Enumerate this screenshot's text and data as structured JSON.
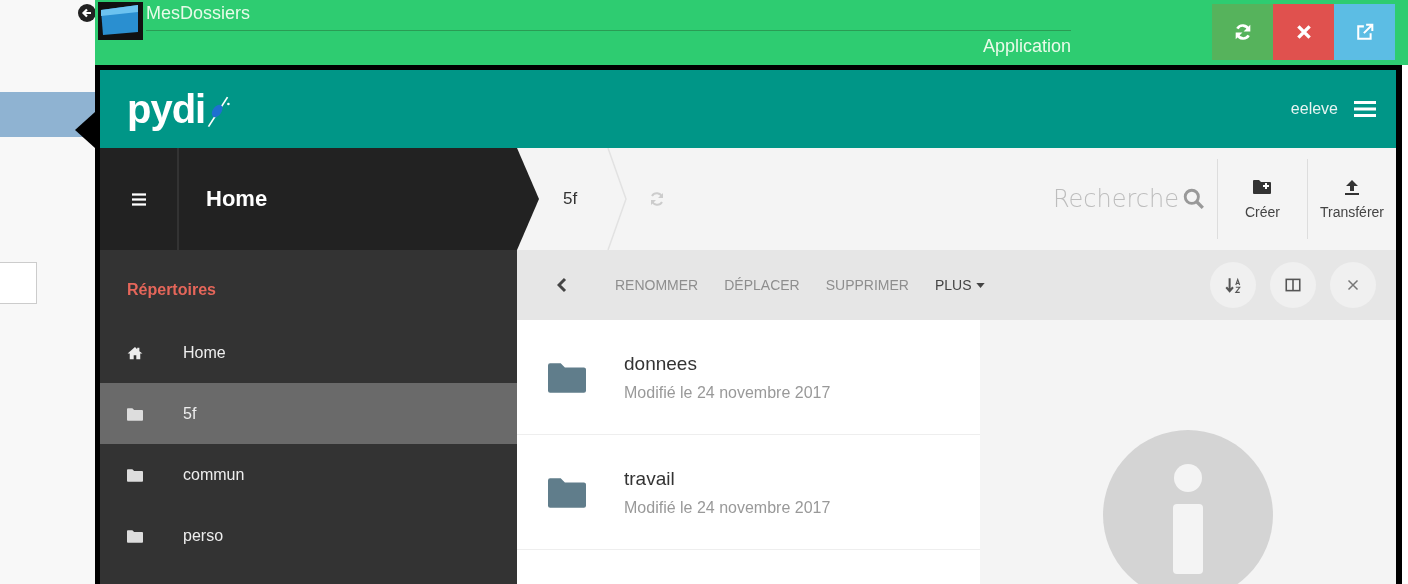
{
  "outer_window": {
    "title": "MesDossiers",
    "subtitle": "Application",
    "buttons": [
      {
        "kind": "refresh"
      },
      {
        "kind": "close"
      },
      {
        "kind": "popout"
      }
    ]
  },
  "header": {
    "logo": "pydi",
    "username": "eeleve"
  },
  "sidebar": {
    "title": "Home",
    "section": "Répertoires",
    "items": [
      {
        "label": "Home",
        "kind": "home",
        "selected": false
      },
      {
        "label": "5f",
        "kind": "folder",
        "selected": true
      },
      {
        "label": "commun",
        "kind": "folder",
        "selected": false
      },
      {
        "label": "perso",
        "kind": "folder",
        "selected": false
      }
    ]
  },
  "breadcrumb": [
    "5f"
  ],
  "search": {
    "placeholder": "Recherche"
  },
  "actions": [
    {
      "label": "Créer",
      "kind": "new-folder"
    },
    {
      "label": "Transférer",
      "kind": "upload"
    }
  ],
  "toolbar": {
    "buttons": [
      {
        "label": "RENOMMER",
        "disabled": true,
        "kind": "plain"
      },
      {
        "label": "DÉPLACER",
        "disabled": true,
        "kind": "plain"
      },
      {
        "label": "SUPPRIMER",
        "disabled": true,
        "kind": "plain"
      },
      {
        "label": "PLUS",
        "disabled": false,
        "kind": "menu"
      }
    ],
    "tools": [
      {
        "kind": "sort"
      },
      {
        "kind": "columns"
      },
      {
        "kind": "close"
      }
    ]
  },
  "files": [
    {
      "name": "donnees",
      "modified": "Modifié le 24 novembre 2017"
    },
    {
      "name": "travail",
      "modified": "Modifié le 24 novembre 2017"
    }
  ]
}
